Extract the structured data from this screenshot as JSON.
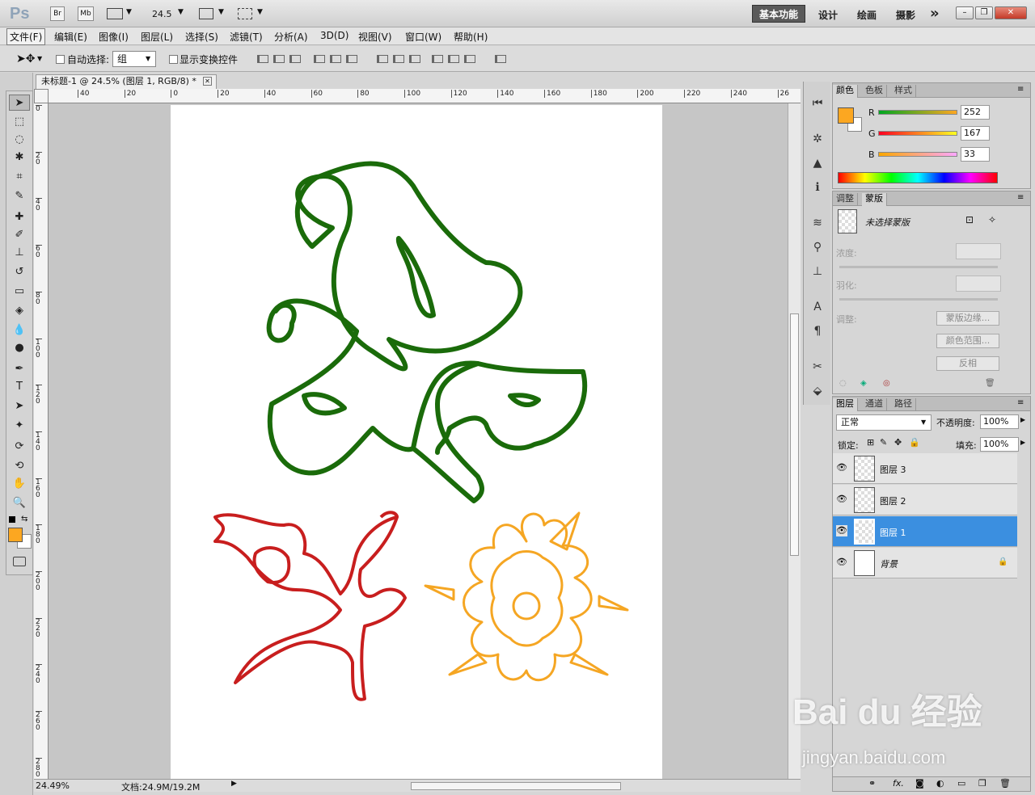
{
  "app": {
    "logo": "Ps",
    "zoom_value": "24.5",
    "workspace_active": "基本功能",
    "workspaces": [
      "设计",
      "绘画",
      "摄影"
    ],
    "more": "»"
  },
  "topbar": {
    "bridge": "Br",
    "minibridge": "Mb"
  },
  "menus": [
    "文件(F)",
    "编辑(E)",
    "图像(I)",
    "图层(L)",
    "选择(S)",
    "滤镜(T)",
    "分析(A)",
    "3D(D)",
    "视图(V)",
    "窗口(W)",
    "帮助(H)"
  ],
  "options": {
    "auto_select_label": "自动选择:",
    "auto_select_value": "组",
    "show_transform_label": "显示变换控件"
  },
  "document": {
    "tab_title": "未标题-1 @ 24.5% (图层 1, RGB/8) *",
    "h_ruler": [
      "40",
      "20",
      "0",
      "20",
      "40",
      "60",
      "80",
      "100",
      "120",
      "140",
      "160",
      "180",
      "200",
      "220",
      "240",
      "26"
    ],
    "v_ruler": [
      "0",
      "2 0",
      "4 0",
      "6 0",
      "8 0",
      "1 0 0",
      "1 2 0",
      "1 4 0",
      "1 6 0",
      "1 8 0",
      "2 0 0",
      "2 2 0",
      "2 4 0",
      "2 6 0",
      "2 8 0"
    ],
    "status_zoom": "24.49%",
    "status_doc": "文档:24.9M/19.2M"
  },
  "colors": {
    "foreground": "#fca721",
    "green_shape": "#1a6b0a",
    "red_shape": "#c81e1e",
    "orange_shape": "#f5a623",
    "selection": "#3b8fe0"
  },
  "color_panel": {
    "tabs": [
      "颜色",
      "色板",
      "样式"
    ],
    "r_label": "R",
    "r_value": "252",
    "g_label": "G",
    "g_value": "167",
    "b_label": "B",
    "b_value": "33"
  },
  "mask_panel": {
    "tabs": [
      "调整",
      "蒙版"
    ],
    "no_mask": "未选择蒙版",
    "density": "浓度:",
    "feather": "羽化:",
    "refine": "调整:",
    "btn_edge": "蒙版边缘...",
    "btn_range": "颜色范围...",
    "btn_invert": "反相"
  },
  "layers_panel": {
    "tabs": [
      "图层",
      "通道",
      "路径"
    ],
    "blend_mode": "正常",
    "opacity_label": "不透明度:",
    "opacity_value": "100%",
    "lock_label": "锁定:",
    "fill_label": "填充:",
    "fill_value": "100%",
    "layers": [
      {
        "name": "图层 3"
      },
      {
        "name": "图层 2"
      },
      {
        "name": "图层 1"
      },
      {
        "name": "背景"
      }
    ]
  },
  "watermark": {
    "brand": "Bai du 经验",
    "url": "jingyan.baidu.com"
  }
}
